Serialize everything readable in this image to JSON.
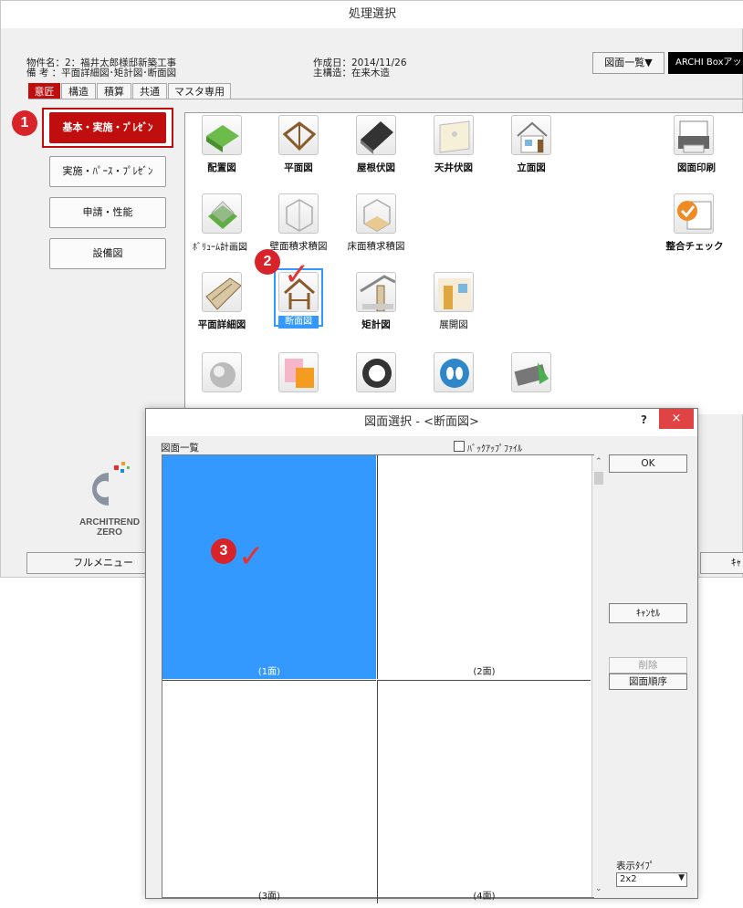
{
  "main_window": {
    "title": "処理選択",
    "info": {
      "project_line": "物件名：2：福井太郎様邸新築工事",
      "note_line": "備 考 ：平面詳細図･矩計図･断面図",
      "created_line": "作成日：2014/11/26",
      "structure_line": "主構造：在来木造"
    },
    "drawing_list_button": "図面一覧▼",
    "archi_box_button": "ARCHI Boxアッ",
    "tabs": [
      "意匠",
      "構造",
      "積算",
      "共通",
      "マスタ専用"
    ],
    "side_buttons": [
      "基本・実施・ﾌﾟﾚｾﾞﾝ",
      "実施・ﾊﾟｰｽ・ﾌﾟﾚｾﾞﾝ",
      "申請・性能",
      "設備図"
    ],
    "icons": [
      {
        "label": "配置図",
        "icon": "site-plan-icon"
      },
      {
        "label": "平面図",
        "icon": "floor-plan-icon"
      },
      {
        "label": "屋根伏図",
        "icon": "roof-plan-icon"
      },
      {
        "label": "天井伏図",
        "icon": "ceiling-plan-icon"
      },
      {
        "label": "立面図",
        "icon": "elevation-icon"
      },
      {
        "label": "図面印刷",
        "icon": "printer-icon"
      },
      {
        "label": "ﾎﾞﾘｭｰﾑ計画図",
        "icon": "volume-plan-icon"
      },
      {
        "label": "壁面積求積図",
        "icon": "wall-area-icon"
      },
      {
        "label": "床面積求積図",
        "icon": "floor-area-icon"
      },
      {
        "label": "整合チェック",
        "icon": "consistency-check-icon"
      },
      {
        "label": "平面詳細図",
        "icon": "detail-plan-icon"
      },
      {
        "label": "断面図",
        "icon": "section-icon"
      },
      {
        "label": "矩計図",
        "icon": "sectional-detail-icon"
      },
      {
        "label": "展開図",
        "icon": "interior-elevation-icon"
      }
    ],
    "logo": {
      "line1": "ARCHITREND",
      "line2": "ZERO"
    },
    "full_menu_button": "フルメニュー",
    "cancel_partial": "ｷｬ"
  },
  "dialog": {
    "title": "図面選択 - <断面図>",
    "help_label": "?",
    "close_label": "×",
    "list_label": "図面一覧",
    "backup_label": "ﾊﾞｯｸｱｯﾌﾟﾌｧｲﾙ",
    "cells": [
      "(1面)",
      "(2面)",
      "(3面)",
      "(4面)"
    ],
    "ok_button": "OK",
    "cancel_button": "ｷｬﾝｾﾙ",
    "delete_button": "削除",
    "order_button": "図面順序",
    "display_type_label": "表示ﾀｲﾌﾟ",
    "display_type_value": "2x2"
  },
  "steps": [
    "1",
    "2",
    "3"
  ],
  "colors": {
    "accent": "#c00d0d",
    "selection": "#3399ff",
    "step": "#d8232a",
    "close": "#e04343"
  }
}
